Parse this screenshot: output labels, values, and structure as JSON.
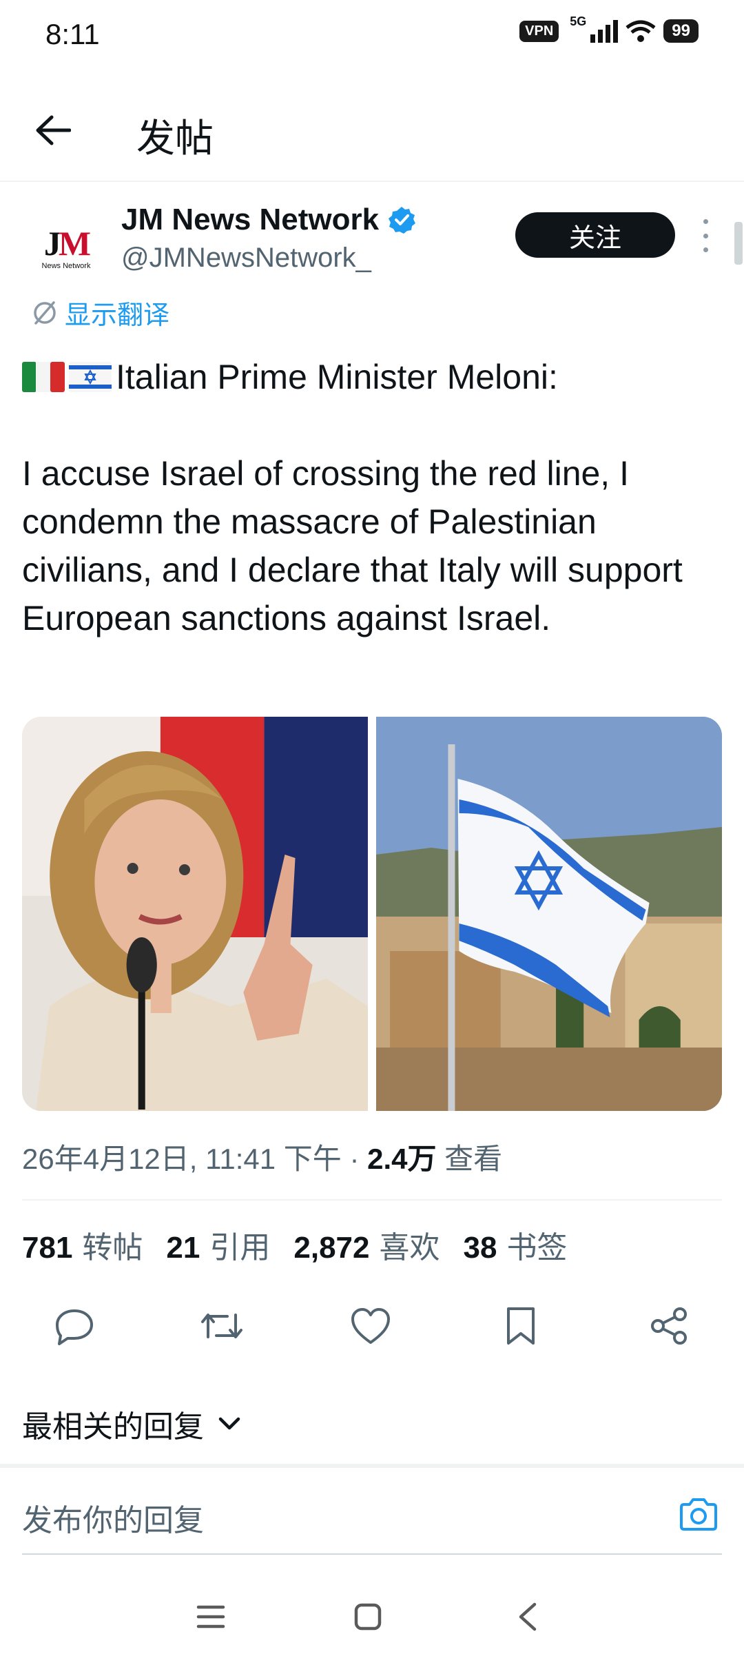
{
  "status_bar": {
    "time": "8:11",
    "vpn": "VPN",
    "network": "5G",
    "battery": "99"
  },
  "header": {
    "title": "发帖"
  },
  "tweet": {
    "author": {
      "display_name": "JM News Network",
      "handle": "@JMNewsNetwork_",
      "verified": true,
      "avatar_logo_j": "J",
      "avatar_logo_m": "M",
      "avatar_subtitle": "News Network"
    },
    "follow_label": "关注",
    "translate_label": "显示翻译",
    "text_line1": "Italian Prime Minister Meloni:",
    "text_body": "I accuse Israel of crossing the red line, I condemn the massacre of Palestinian civilians, and I declare that Italy will support European sanctions against Israel.",
    "meta": {
      "date_time": "26年4月12日, 11:41 下午 · ",
      "views_count": "2.4万",
      "views_label": " 查看"
    },
    "stats": {
      "reposts_count": "781",
      "reposts_label": "转帖",
      "quotes_count": "21",
      "quotes_label": "引用",
      "likes_count": "2,872",
      "likes_label": "喜欢",
      "bookmarks_count": "38",
      "bookmarks_label": "书签"
    }
  },
  "replies": {
    "sort_label": "最相关的回复",
    "input_placeholder": "发布你的回复"
  },
  "colors": {
    "accent": "#1d9bf0",
    "text_primary": "#0f1419",
    "text_secondary": "#536471",
    "follow_bg": "#0f1419"
  },
  "icons": [
    "back-arrow-icon",
    "verified-badge-icon",
    "translate-icon",
    "italy-flag-icon",
    "israel-flag-icon",
    "reply-icon",
    "repost-icon",
    "like-icon",
    "bookmark-icon",
    "share-icon",
    "chevron-down-icon",
    "camera-icon",
    "menu-icon",
    "home-icon",
    "back-nav-icon"
  ]
}
